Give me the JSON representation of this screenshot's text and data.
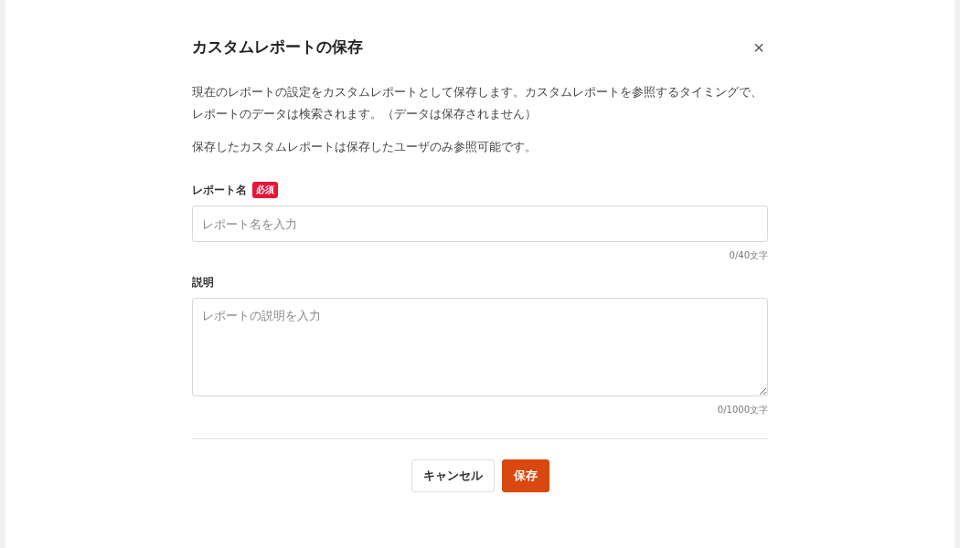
{
  "dialog": {
    "title": "カスタムレポートの保存",
    "close": "×",
    "description": [
      "現在のレポートの設定をカスタムレポートとして保存します。カスタムレポートを参照するタイミングで、レポートのデータは検索されます。（データは保存されません）",
      "保存したカスタムレポートは保存したユーザのみ参照可能です。"
    ],
    "fields": [
      {
        "kind": "input",
        "label": "レポート名",
        "badge": "必須",
        "placeholder": "レポート名を入力",
        "counter": "0/40文字"
      },
      {
        "kind": "textarea",
        "label": "説明",
        "placeholder": "レポートの説明を入力",
        "counter": "0/1000文字"
      }
    ],
    "buttons": [
      {
        "label": "キャンセル",
        "kind": "secondary"
      },
      {
        "label": "保存",
        "kind": "primary"
      }
    ]
  }
}
